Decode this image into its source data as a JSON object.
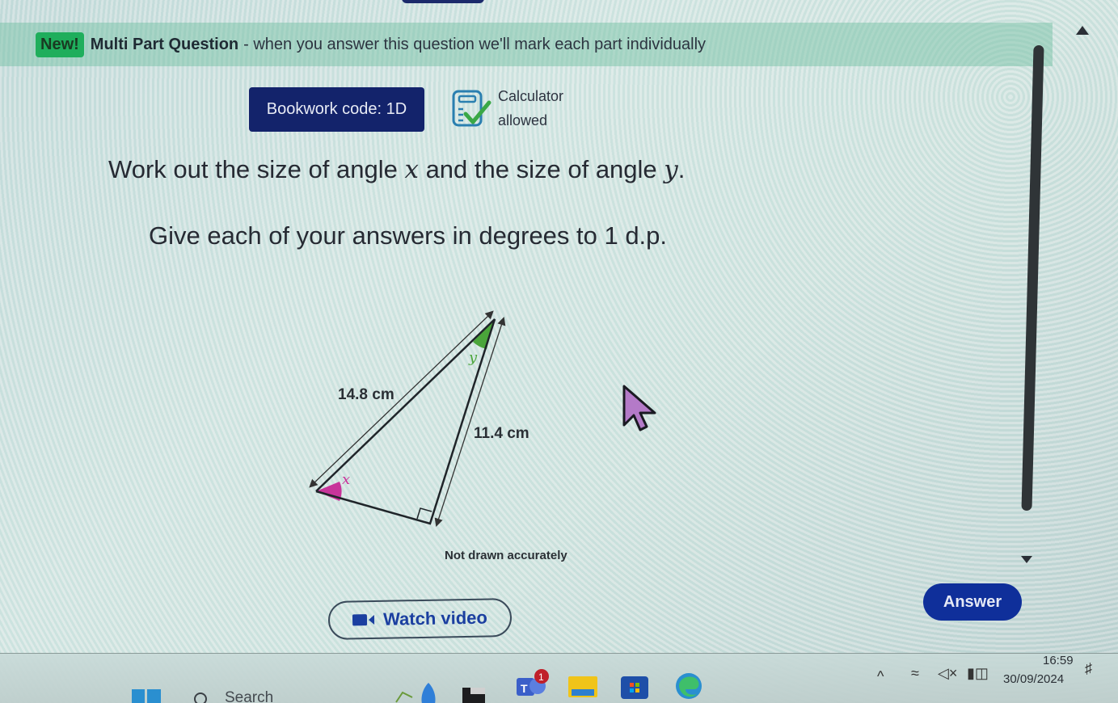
{
  "banner": {
    "badge": "New!",
    "title": "Multi Part Question",
    "description": "- when you answer this question we'll mark each part individually"
  },
  "bookwork": {
    "label": "Bookwork code: 1D"
  },
  "calculator": {
    "line1": "Calculator",
    "line2": "allowed",
    "icon": "calculator-check-icon"
  },
  "question": {
    "line1_pre": "Work out the size of angle ",
    "var_x": "x",
    "line1_mid": " and the size of angle ",
    "var_y": "y",
    "line1_post": ".",
    "line2": "Give each of your answers in degrees to 1 d.p."
  },
  "diagram": {
    "hypotenuse_label": "14.8 cm",
    "side_label": "11.4 cm",
    "angle_x": "x",
    "angle_y": "y",
    "note": "Not drawn accurately",
    "colors": {
      "angle_x": "#c8349a",
      "angle_y": "#4aa53a"
    }
  },
  "buttons": {
    "watch_video": "Watch video",
    "answer": "Answer"
  },
  "taskbar": {
    "search_placeholder": "Search",
    "teams_badge": "1",
    "time": "16:59",
    "date": "30/09/2024"
  },
  "colors": {
    "brand_navy": "#13236b",
    "answer_blue": "#0f2f9a",
    "new_badge_green": "#1fae5c"
  }
}
